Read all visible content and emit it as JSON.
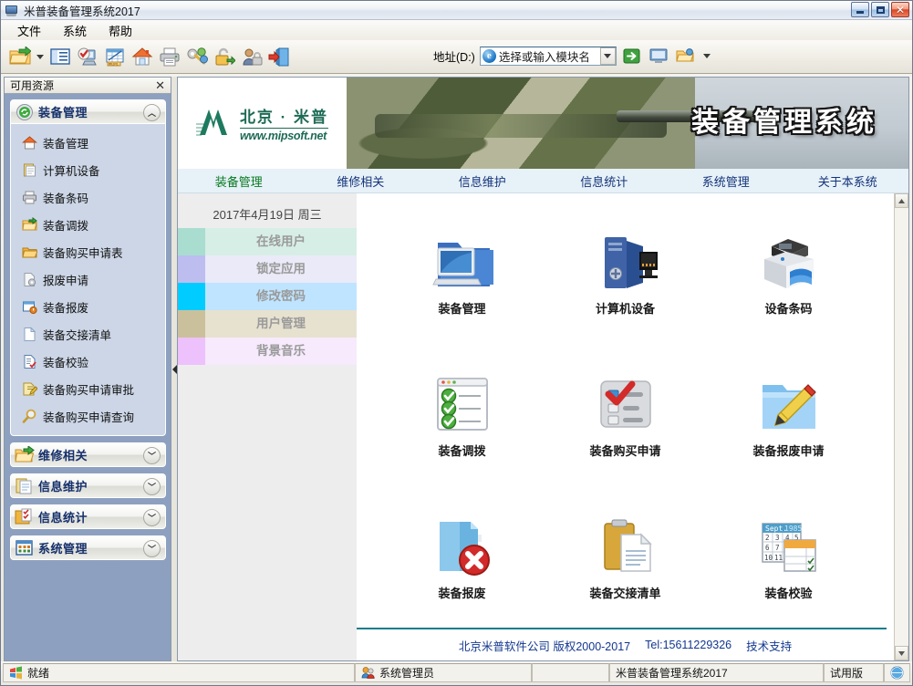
{
  "window": {
    "title": "米普装备管理系统2017",
    "icon": "app-window-icon",
    "controls": {
      "minimize": "_",
      "maximize": "□",
      "close": "✕"
    }
  },
  "menubar": {
    "items": [
      "文件",
      "系统",
      "帮助"
    ]
  },
  "toolbar": {
    "buttons": [
      {
        "name": "open-folder-icon",
        "tip": "打开"
      },
      {
        "name": "dropdown-caret-icon",
        "tip": "更多"
      },
      {
        "name": "details-list-icon",
        "tip": "列表"
      },
      {
        "name": "computer-check-icon",
        "tip": "计算机"
      },
      {
        "name": "spreadsheet-icon",
        "tip": "报表"
      },
      {
        "name": "home-icon",
        "tip": "主页"
      },
      {
        "name": "printer-icon",
        "tip": "打印"
      },
      {
        "name": "keys-icon",
        "tip": "权限"
      },
      {
        "name": "lock-open-icon",
        "tip": "解锁"
      },
      {
        "name": "user-lock-icon",
        "tip": "用户锁定"
      },
      {
        "name": "exit-door-icon",
        "tip": "退出"
      }
    ],
    "address": {
      "label": "地址(D:)",
      "label_prefix": "地址(",
      "label_key": "D",
      "label_suffix": ":)",
      "value": "选择或输入模块名",
      "placeholder": "选择或输入模块名",
      "icon": "internet-explorer-icon",
      "go_icon": "go-arrow-icon",
      "computer_icon": "computer-icon",
      "folder_icon": "folder-icon",
      "caret_icon": "chevron-down-icon"
    }
  },
  "sidebar": {
    "title": "可用资源",
    "close_label": "✕",
    "groups": [
      {
        "label": "装备管理",
        "icon": "refresh-green-icon",
        "expanded": true,
        "chevron": "︿",
        "items": [
          {
            "label": "装备管理",
            "icon": "home-orange-icon"
          },
          {
            "label": "计算机设备",
            "icon": "clipboard-icon"
          },
          {
            "label": "装备条码",
            "icon": "printer-small-icon"
          },
          {
            "label": "装备调拨",
            "icon": "folder-arrow-icon"
          },
          {
            "label": "装备购买申请表",
            "icon": "folder-open-icon"
          },
          {
            "label": "报废申请",
            "icon": "gear-page-icon"
          },
          {
            "label": "装备报废",
            "icon": "window-alert-icon"
          },
          {
            "label": "装备交接清单",
            "icon": "page-icon"
          },
          {
            "label": "装备校验",
            "icon": "page-check-icon"
          },
          {
            "label": "装备购买申请审批",
            "icon": "page-edit-icon"
          },
          {
            "label": "装备购买申请查询",
            "icon": "magnifier-icon"
          }
        ]
      },
      {
        "label": "维修相关",
        "icon": "folder-arrow-green-icon",
        "expanded": false,
        "chevron": "﹀",
        "items": []
      },
      {
        "label": "信息维护",
        "icon": "clipboard-yellow-icon",
        "expanded": false,
        "chevron": "﹀",
        "items": []
      },
      {
        "label": "信息统计",
        "icon": "folder-check-icon",
        "expanded": false,
        "chevron": "﹀",
        "items": []
      },
      {
        "label": "系统管理",
        "icon": "grid-window-icon",
        "expanded": false,
        "chevron": "﹀",
        "items": []
      }
    ]
  },
  "banner": {
    "logo_cn": "北京 · 米普",
    "logo_url": "www.mipsoft.net",
    "title": "装备管理系统",
    "image": "military-tank-photo"
  },
  "nav": {
    "tabs": [
      {
        "label": "装备管理",
        "active": true
      },
      {
        "label": "维修相关",
        "active": false
      },
      {
        "label": "信息维护",
        "active": false
      },
      {
        "label": "信息统计",
        "active": false
      },
      {
        "label": "系统管理",
        "active": false
      },
      {
        "label": "关于本系统",
        "active": false
      }
    ],
    "active_color": "#0a7a22",
    "inactive_color": "#13347a"
  },
  "shortcut_panel": {
    "date": "2017年4月19日  周三",
    "items": [
      {
        "label": "在线用户",
        "swatch": "#a9ddd0",
        "bg": "#d7eee6"
      },
      {
        "label": "锁定应用",
        "swatch": "#bdbdf0",
        "bg": "#eaeaf8"
      },
      {
        "label": "修改密码",
        "swatch": "#00ccff",
        "bg": "#bfe4ff"
      },
      {
        "label": "用户管理",
        "swatch": "#cbc09c",
        "bg": "#e7e1d0"
      },
      {
        "label": "背景音乐",
        "swatch": "#edc1fb",
        "bg": "#f6eafc"
      }
    ]
  },
  "tiles": [
    {
      "label": "装备管理",
      "icon": "folder-monitor-icon"
    },
    {
      "label": "计算机设备",
      "icon": "desktop-pc-icon"
    },
    {
      "label": "设备条码",
      "icon": "barcode-printer-icon"
    },
    {
      "label": "装备调拨",
      "icon": "checklist-window-icon"
    },
    {
      "label": "装备购买申请",
      "icon": "checklist-red-check-icon"
    },
    {
      "label": "装备报废申请",
      "icon": "folder-pencil-icon"
    },
    {
      "label": "装备报废",
      "icon": "folder-delete-icon"
    },
    {
      "label": "装备交接清单",
      "icon": "clipboard-document-icon"
    },
    {
      "label": "装备校验",
      "icon": "calendar-table-icon"
    }
  ],
  "footer": {
    "company": "北京米普软件公司  版权2000-2017",
    "tel": "Tel:15611229326",
    "support": "技术支持"
  },
  "statusbar": {
    "ready": "就绪",
    "ready_icon": "windows-flag-icon",
    "user": "系统管理员",
    "user_icon": "users-icon",
    "product": "米普装备管理系统2017",
    "edition": "试用版",
    "edition_icon": "globe-icon"
  }
}
